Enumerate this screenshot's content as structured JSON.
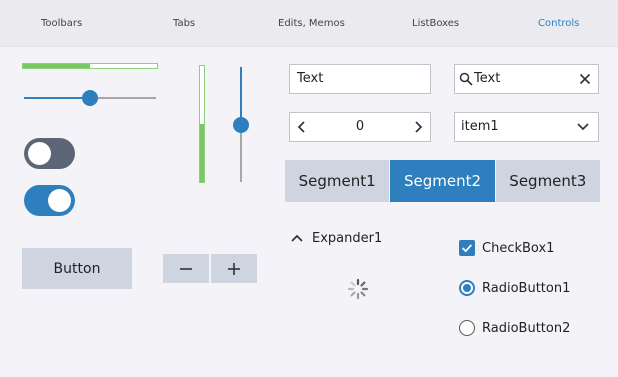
{
  "tabs": [
    {
      "label": "Toolbars"
    },
    {
      "label": "Tabs"
    },
    {
      "label": "Edits, Memos"
    },
    {
      "label": "ListBoxes"
    },
    {
      "label": "Controls"
    }
  ],
  "active_tab": "Controls",
  "colors": {
    "accent": "#2d7fbe",
    "progress": "#79c962",
    "control_bg": "#cfd5e0",
    "toggle_off": "#5d6676"
  },
  "progress_horizontal": {
    "value_fraction": 0.5
  },
  "slider_horizontal": {
    "value_fraction": 0.5
  },
  "progress_vertical": {
    "value_fraction": 0.5
  },
  "slider_vertical": {
    "value_fraction": 0.5
  },
  "toggle_off": {
    "state": "off"
  },
  "toggle_on": {
    "state": "on"
  },
  "button": {
    "label": "Button"
  },
  "stepper": {
    "minus_icon": "minus-icon",
    "plus_icon": "plus-icon"
  },
  "text_edit": {
    "value": "Text"
  },
  "search_edit": {
    "value": "Text",
    "icon": "search-icon",
    "clear_icon": "close-icon"
  },
  "number_box": {
    "value": "0"
  },
  "combo_box": {
    "value": "item1"
  },
  "segments": [
    {
      "label": "Segment1"
    },
    {
      "label": "Segment2"
    },
    {
      "label": "Segment3"
    }
  ],
  "active_segment": "Segment2",
  "expander": {
    "label": "Expander1",
    "expanded": true
  },
  "checkbox": {
    "label": "CheckBox1",
    "checked": true
  },
  "radio1": {
    "label": "RadioButton1",
    "checked": true
  },
  "radio2": {
    "label": "RadioButton2",
    "checked": false
  }
}
